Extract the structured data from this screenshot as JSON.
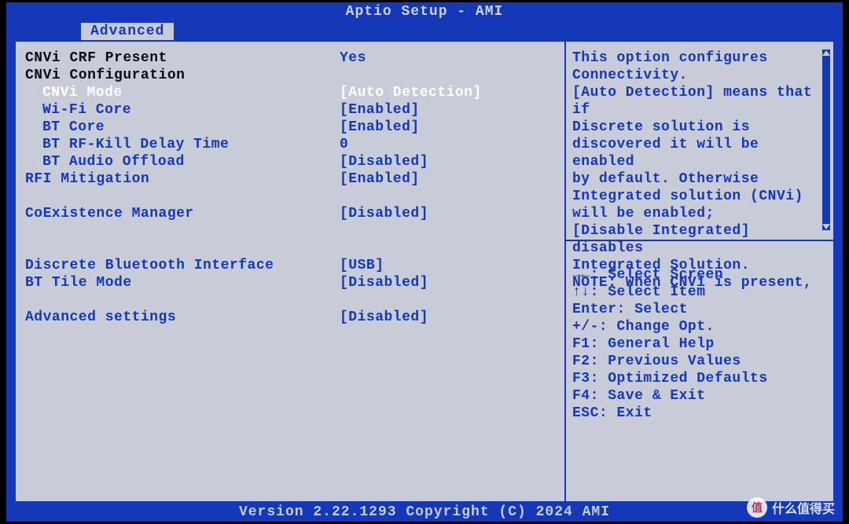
{
  "title": "Aptio Setup - AMI",
  "tab": "Advanced",
  "footer": "Version 2.22.1293 Copyright (C) 2024 AMI",
  "settings": {
    "cnvi_crf_present": {
      "label": "CNVi CRF Present",
      "value": "Yes"
    },
    "cnvi_config": {
      "label": "CNVi Configuration",
      "value": ""
    },
    "cnvi_mode": {
      "label": "CNVi Mode",
      "value": "[Auto Detection]"
    },
    "wifi_core": {
      "label": "Wi-Fi Core",
      "value": "[Enabled]"
    },
    "bt_core": {
      "label": "BT Core",
      "value": "[Enabled]"
    },
    "bt_rfkill": {
      "label": "BT RF-Kill Delay Time",
      "value": "0"
    },
    "bt_audio": {
      "label": "BT Audio Offload",
      "value": "[Disabled]"
    },
    "rfi": {
      "label": "RFI Mitigation",
      "value": "[Enabled]"
    },
    "coex": {
      "label": "CoExistence Manager",
      "value": "[Disabled]"
    },
    "discrete_bt": {
      "label": "Discrete Bluetooth Interface",
      "value": "[USB]"
    },
    "bt_tile": {
      "label": "BT Tile Mode",
      "value": "[Disabled]"
    },
    "adv": {
      "label": "Advanced settings",
      "value": "[Disabled]"
    }
  },
  "help": {
    "l1": "This option configures",
    "l2": "Connectivity.",
    "l3": "[Auto Detection] means that if",
    "l4": "Discrete solution is",
    "l5": "discovered it will be enabled",
    "l6": "by default. Otherwise",
    "l7": "Integrated solution (CNVi)",
    "l8": "will be enabled;",
    "l9": "[Disable Integrated] disables",
    "l10": "Integrated Solution.",
    "l11": "NOTE: When CNVi is present,"
  },
  "keys": {
    "k1": "→←: Select Screen",
    "k2": "↑↓: Select Item",
    "k3": "Enter: Select",
    "k4": "+/-: Change Opt.",
    "k5": "F1: General Help",
    "k6": "F2: Previous Values",
    "k7": "F3: Optimized Defaults",
    "k8": "F4: Save & Exit",
    "k9": "ESC: Exit"
  },
  "watermark": "什么值得买"
}
